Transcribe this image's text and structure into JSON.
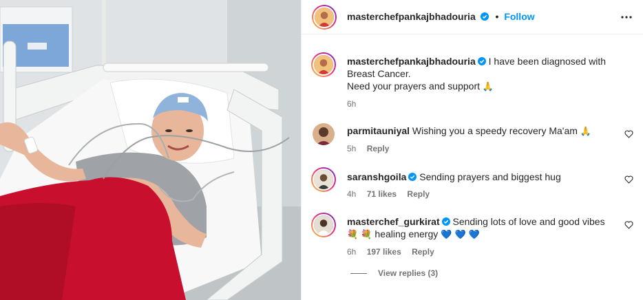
{
  "post": {
    "author": "masterchefpankajbhadouria",
    "follow_label": "Follow",
    "dot": "•",
    "caption": "I have been diagnosed with Breast Cancer.",
    "caption_line2": "Need your prayers and support",
    "caption_emoji": "🙏",
    "time": "6h"
  },
  "comments": [
    {
      "user": "parmitauniyal",
      "text": "Wishing you a speedy recovery Ma'am",
      "emoji": "🙏",
      "time": "5h",
      "likes": "",
      "reply_label": "Reply"
    },
    {
      "user": "saranshgoila",
      "text": "Sending prayers and biggest hug",
      "emoji": "",
      "time": "4h",
      "likes": "71 likes",
      "reply_label": "Reply"
    },
    {
      "user": "masterchef_gurkirat",
      "text": "Sending lots of love and good vibes",
      "text_line2_prefix": "💐 💐",
      "text_line2": "healing energy",
      "text_line2_suffix": "💙 💙 💙",
      "time": "6h",
      "likes": "197 likes",
      "reply_label": "Reply"
    }
  ],
  "view_replies": "View replies (3)",
  "colors": {
    "accent": "#0095f6",
    "muted": "#737373",
    "blanket": "#c8102e"
  },
  "icons": [
    "verified-badge-icon",
    "more-options-icon",
    "heart-icon"
  ]
}
